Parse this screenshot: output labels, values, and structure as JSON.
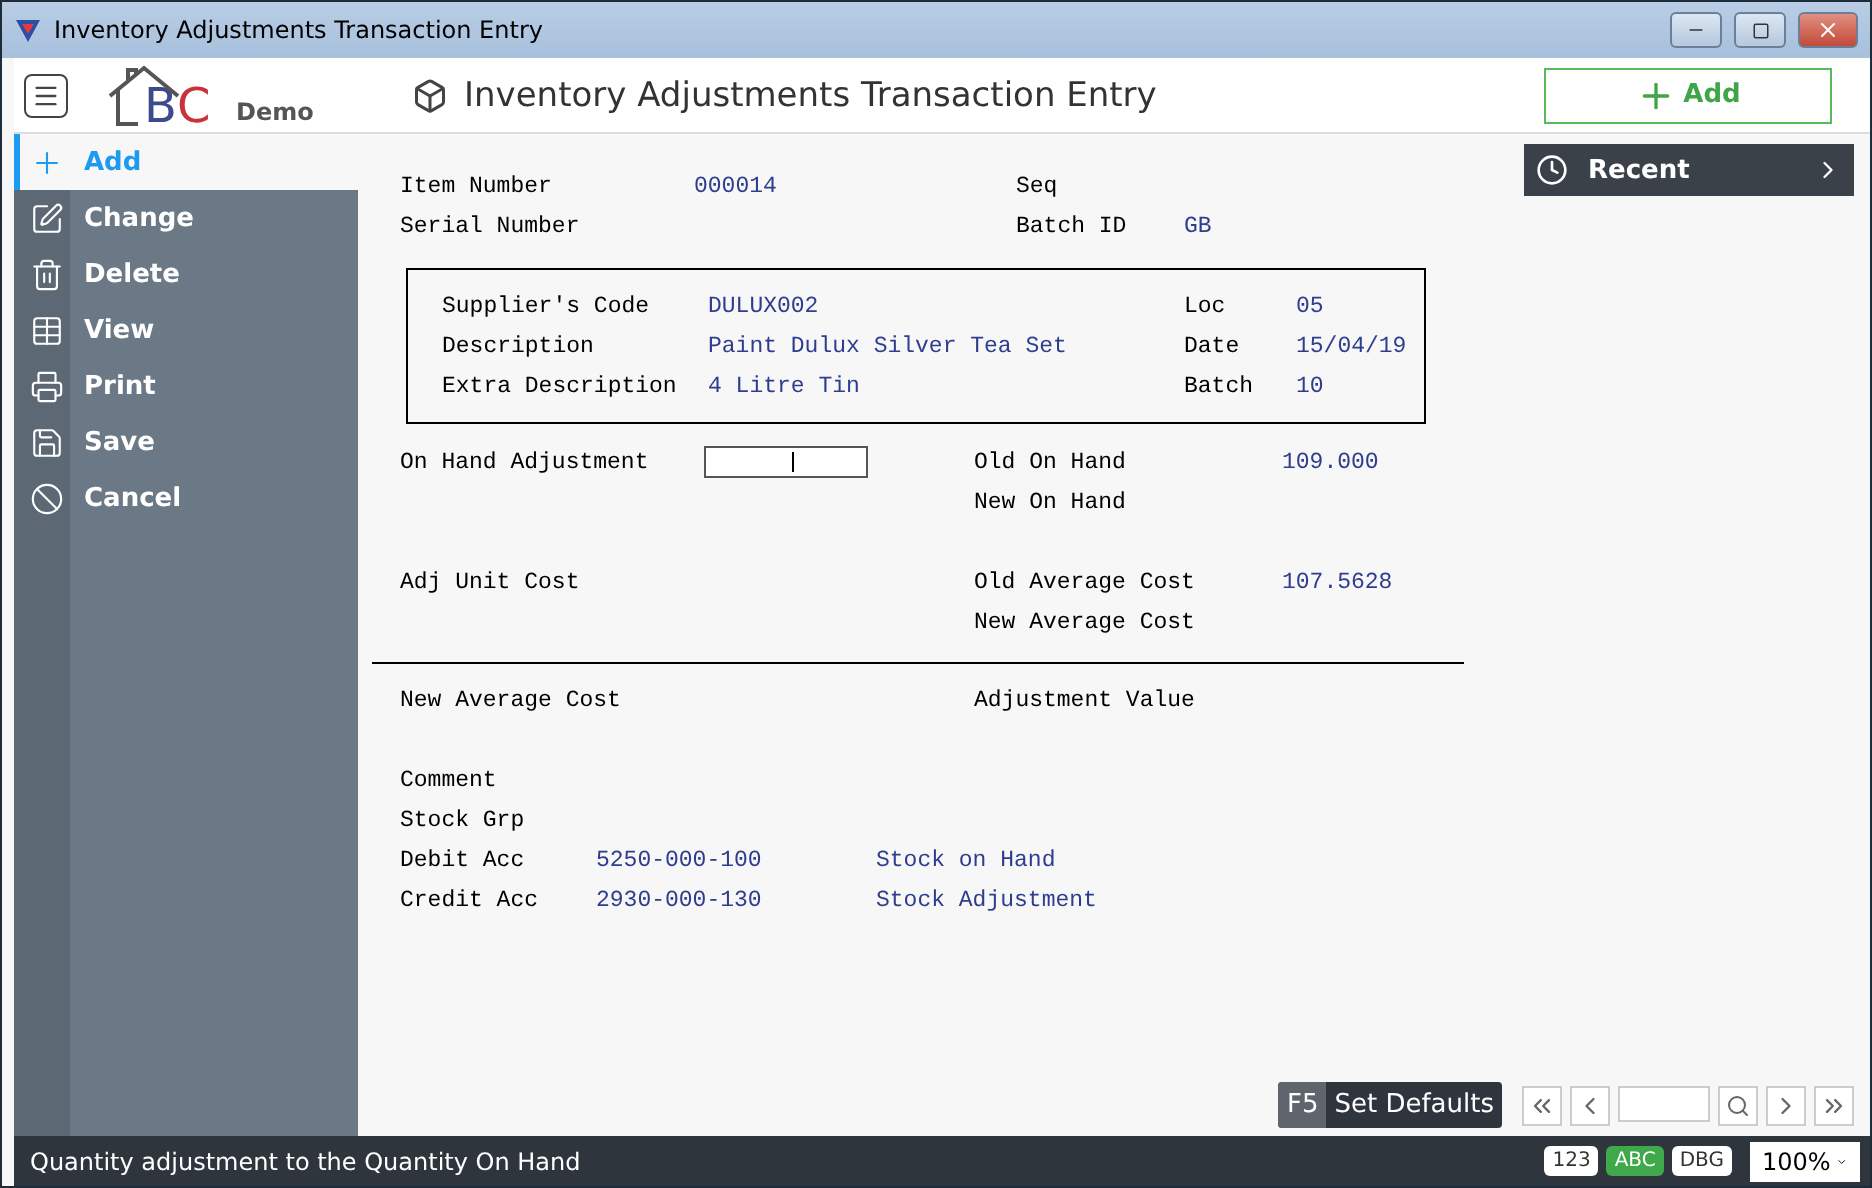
{
  "window": {
    "title": "Inventory Adjustments Transaction Entry"
  },
  "header": {
    "logo": {
      "letters": [
        "B",
        "C"
      ],
      "tag": "Demo"
    },
    "title": "Inventory Adjustments Transaction Entry",
    "add_button": "Add"
  },
  "sidebar": {
    "items": [
      {
        "label": "Add",
        "selected": true
      },
      {
        "label": "Change",
        "selected": false
      },
      {
        "label": "Delete",
        "selected": false
      },
      {
        "label": "View",
        "selected": false
      },
      {
        "label": "Print",
        "selected": false
      },
      {
        "label": "Save",
        "selected": false
      },
      {
        "label": "Cancel",
        "selected": false
      }
    ]
  },
  "recent": {
    "label": "Recent"
  },
  "form": {
    "top": [
      {
        "label": "Item Number",
        "value": "000014",
        "right_label": "Seq"
      },
      {
        "label": "Serial Number",
        "right_label": "Batch ID",
        "right_value": "GB"
      }
    ],
    "supplier_box": [
      {
        "label": "Supplier's Code",
        "value": "DULUX002",
        "right_label": "Loc",
        "right_value": "05"
      },
      {
        "label": "Description",
        "value": "Paint Dulux Silver Tea Set",
        "right_label": "Date",
        "right_value": "15/04/19"
      },
      {
        "label": "Extra Description",
        "value": "4 Litre Tin",
        "right_label": "Batch",
        "right_value": "10"
      }
    ],
    "on_hand": [
      {
        "label": "On Hand Adjustment",
        "kind": "input",
        "right_label": "Old On Hand",
        "right_value": "109.000"
      },
      {
        "right_label": "New On Hand"
      }
    ],
    "cost": [
      {
        "label": "Adj Unit Cost",
        "right_label": "Old Average Cost",
        "right_value": "107.5628"
      },
      {
        "right_label": "New Average Cost"
      }
    ],
    "totals": [
      {
        "label": "New Average Cost",
        "right_label": "Adjustment Value"
      }
    ],
    "accounts": [
      {
        "label": "Comment"
      },
      {
        "label": "Stock Grp"
      },
      {
        "label": "Debit Acc",
        "value": "5250-000-100",
        "description": "Stock on Hand"
      },
      {
        "label": "Credit Acc",
        "value": "2930-000-130",
        "description": "Stock Adjustment"
      }
    ]
  },
  "footer": {
    "key": "F5",
    "label": "Set Defaults"
  },
  "status_bar": {
    "text": "Quantity adjustment to the Quantity On Hand",
    "badges": [
      {
        "label": "123",
        "selected": false
      },
      {
        "label": "ABC",
        "selected": true
      },
      {
        "label": "DBG",
        "selected": false
      }
    ],
    "zoom": "100%"
  }
}
